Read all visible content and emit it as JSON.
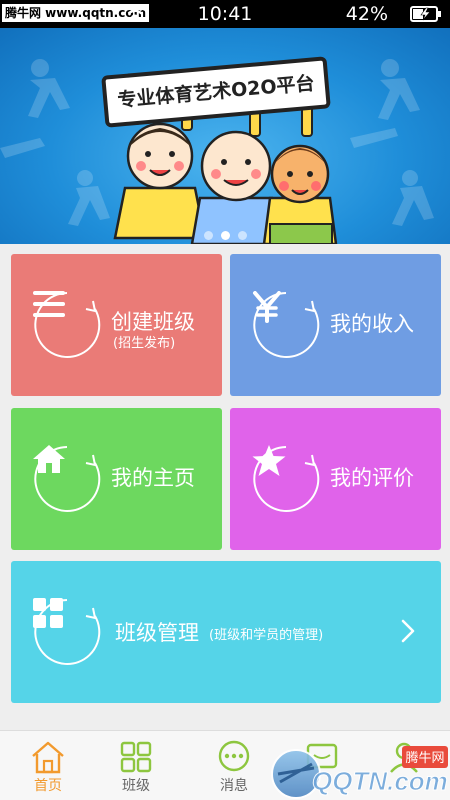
{
  "status_bar": {
    "watermark": "腾牛网 www.qqtn.com",
    "time": "10:41",
    "battery": "42%"
  },
  "banner": {
    "sign_text": "专业体育艺术O2O平台",
    "pages": 3,
    "active_page": 1
  },
  "tiles": {
    "create_class": {
      "title": "创建班级",
      "subtitle": "(招生发布)",
      "color": "#ea7b77"
    },
    "my_income": {
      "title": "我的收入",
      "color": "#6f9de3"
    },
    "my_home": {
      "title": "我的主页",
      "color": "#6dd85f"
    },
    "my_reviews": {
      "title": "我的评价",
      "color": "#e063ea"
    },
    "class_management": {
      "title": "班级管理",
      "subtitle": "(班级和学员的管理)",
      "color": "#55d4e8"
    }
  },
  "bottom_nav": {
    "items": [
      {
        "label": "首页",
        "icon": "home-icon",
        "active": true
      },
      {
        "label": "班级",
        "icon": "grid-icon",
        "active": false
      },
      {
        "label": "消息",
        "icon": "chat-icon",
        "active": false
      },
      {
        "label": "",
        "icon": "message-icon",
        "active": false
      },
      {
        "label": "",
        "icon": "profile-icon",
        "active": false
      }
    ],
    "accent": "#f29a2e",
    "icon_green": "#8dc63f"
  },
  "corner_watermark": {
    "brand": "QQTN.com",
    "badge": "腾牛网"
  }
}
